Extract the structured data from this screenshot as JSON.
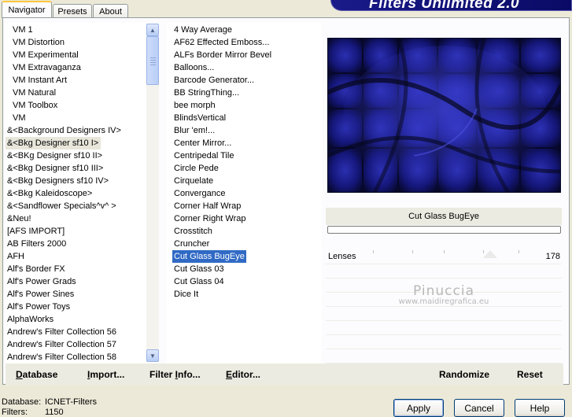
{
  "tabs": [
    {
      "label": "Navigator"
    },
    {
      "label": "Presets"
    },
    {
      "label": "About"
    }
  ],
  "title": "Filters Unlimited 2.0",
  "categories": [
    {
      "label": "VM 1"
    },
    {
      "label": "VM Distortion"
    },
    {
      "label": "VM Experimental"
    },
    {
      "label": "VM Extravaganza"
    },
    {
      "label": "VM Instant Art"
    },
    {
      "label": "VM Natural"
    },
    {
      "label": "VM Toolbox"
    },
    {
      "label": "VM"
    },
    {
      "label": "&<Background Designers IV>"
    },
    {
      "label": "&<Bkg Designer sf10 I>"
    },
    {
      "label": "&<BKg Designer sf10 II>"
    },
    {
      "label": "&<Bkg Designer sf10 III>"
    },
    {
      "label": "&<Bkg Designers sf10 IV>"
    },
    {
      "label": "&<Bkg Kaleidoscope>"
    },
    {
      "label": "&<Sandflower Specials^v^ >"
    },
    {
      "label": "&Neu!"
    },
    {
      "label": "[AFS IMPORT]"
    },
    {
      "label": "AB Filters 2000"
    },
    {
      "label": "AFH"
    },
    {
      "label": "Alf's Border FX"
    },
    {
      "label": "Alf's Power Grads"
    },
    {
      "label": "Alf's Power Sines"
    },
    {
      "label": "Alf's Power Toys"
    },
    {
      "label": "AlphaWorks"
    },
    {
      "label": "Andrew's Filter Collection 56"
    },
    {
      "label": "Andrew's Filter Collection 57"
    },
    {
      "label": "Andrew's Filter Collection 58"
    }
  ],
  "highlighted_category_index": 9,
  "filters": [
    {
      "label": "4 Way Average"
    },
    {
      "label": "AF62 Effected Emboss..."
    },
    {
      "label": "ALFs Border Mirror Bevel"
    },
    {
      "label": "Balloons..."
    },
    {
      "label": "Barcode Generator..."
    },
    {
      "label": "BB StringThing..."
    },
    {
      "label": "bee morph"
    },
    {
      "label": "BlindsVertical"
    },
    {
      "label": "Blur 'em!..."
    },
    {
      "label": "Center Mirror..."
    },
    {
      "label": "Centripedal Tile"
    },
    {
      "label": "Circle Pede"
    },
    {
      "label": "Cirquelate"
    },
    {
      "label": "Convergance"
    },
    {
      "label": "Corner Half Wrap"
    },
    {
      "label": "Corner Right Wrap"
    },
    {
      "label": "Crosstitch"
    },
    {
      "label": "Cruncher"
    },
    {
      "label": "Cut Glass  BugEye"
    },
    {
      "label": "Cut Glass 03"
    },
    {
      "label": "Cut Glass 04"
    },
    {
      "label": "Dice It"
    }
  ],
  "selected_filter_index": 18,
  "preview": {
    "filter_name": "Cut Glass  BugEye"
  },
  "params": [
    {
      "label": "Lenses",
      "value": "178"
    }
  ],
  "watermark": {
    "line1": "Pinuccia",
    "line2": "www.maidiregrafica.eu"
  },
  "toolbar": {
    "database": {
      "pre": "",
      "ul": "D",
      "post": "atabase"
    },
    "import": {
      "pre": "",
      "ul": "I",
      "post": "mport..."
    },
    "filter_info": {
      "pre": "Filter ",
      "ul": "I",
      "post": "nfo..."
    },
    "editor": {
      "pre": "",
      "ul": "E",
      "post": "ditor..."
    },
    "randomize": {
      "pre": "",
      "ul": "",
      "post": "Randomize"
    },
    "reset": {
      "pre": "",
      "ul": "",
      "post": "Reset"
    }
  },
  "status": {
    "database_label": "Database:",
    "database_value": "ICNET-Filters",
    "filters_label": "Filters:",
    "filters_value": "1150"
  },
  "buttons": {
    "apply": "Apply",
    "cancel": "Cancel",
    "help": "Help"
  },
  "colors": {
    "selection": "#316ac5",
    "preview_bg": "#0a0c3a",
    "accent_blue": "#2a2ab0"
  },
  "icons": {
    "scroll_up": "chevron-up-icon",
    "scroll_down": "chevron-down-icon"
  }
}
